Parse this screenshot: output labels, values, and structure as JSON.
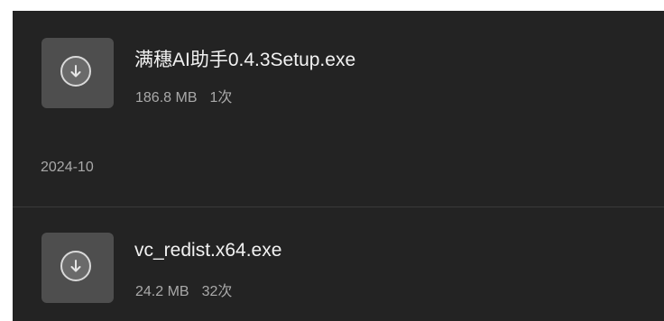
{
  "downloads": {
    "items": [
      {
        "name": "满穗AI助手0.4.3Setup.exe",
        "size": "186.8 MB",
        "count": "1次",
        "icon": "download-icon"
      },
      {
        "name": "vc_redist.x64.exe",
        "size": "24.2 MB",
        "count": "32次",
        "icon": "download-icon"
      }
    ],
    "group_date": "2024-10"
  },
  "colors": {
    "background": "#232323",
    "icon_tile": "#4e4e4e",
    "primary_text": "#f2f2f2",
    "secondary_text": "#a9a9a9"
  }
}
